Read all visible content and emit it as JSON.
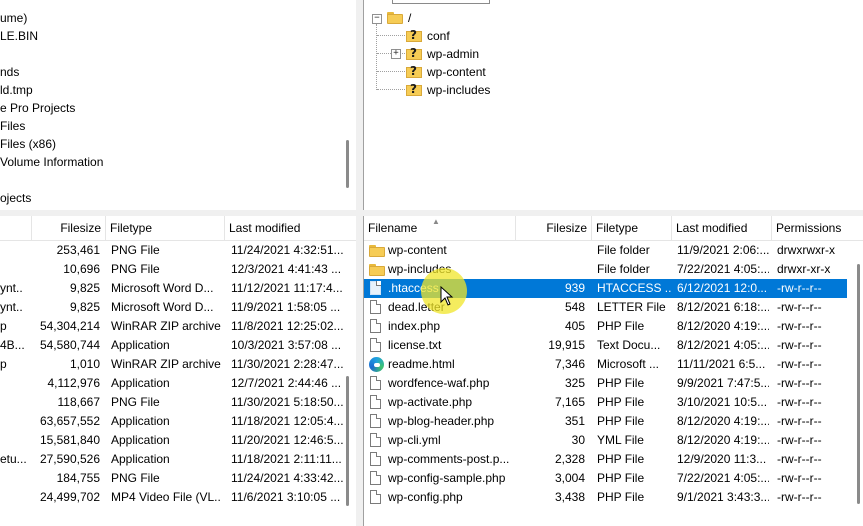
{
  "local_tree": {
    "items": [
      "ume)",
      "LE.BIN",
      "",
      "nds",
      "ld.tmp",
      "e Pro Projects",
      " Files",
      " Files (x86)",
      "Volume Information",
      "",
      "ojects"
    ]
  },
  "remote_tree": {
    "root": "/",
    "items": [
      {
        "name": "conf",
        "expander": false
      },
      {
        "name": "wp-admin",
        "expander": true
      },
      {
        "name": "wp-content",
        "expander": false
      },
      {
        "name": "wp-includes",
        "expander": false
      }
    ]
  },
  "local_list": {
    "headers": {
      "filesize": "Filesize",
      "filetype": "Filetype",
      "modified": "Last modified"
    },
    "rows": [
      {
        "name": "",
        "size": "253,461",
        "type": "PNG File",
        "modified": "11/24/2021 4:32:51..."
      },
      {
        "name": "",
        "size": "10,696",
        "type": "PNG File",
        "modified": "12/3/2021 4:41:43 ..."
      },
      {
        "name": "ynt..",
        "size": "9,825",
        "type": "Microsoft Word D...",
        "modified": "11/12/2021 11:17:4..."
      },
      {
        "name": "ynt..",
        "size": "9,825",
        "type": "Microsoft Word D...",
        "modified": "11/9/2021 1:58:05 ..."
      },
      {
        "name": "p",
        "size": "54,304,214",
        "type": "WinRAR ZIP archive",
        "modified": "11/8/2021 12:25:02..."
      },
      {
        "name": "4B...",
        "size": "54,580,744",
        "type": "Application",
        "modified": "10/3/2021 3:57:08 ..."
      },
      {
        "name": "p",
        "size": "1,010",
        "type": "WinRAR ZIP archive",
        "modified": "11/30/2021 2:28:47..."
      },
      {
        "name": "",
        "size": "4,112,976",
        "type": "Application",
        "modified": "12/7/2021 2:44:46 ..."
      },
      {
        "name": "",
        "size": "118,667",
        "type": "PNG File",
        "modified": "11/30/2021 5:18:50..."
      },
      {
        "name": "",
        "size": "63,657,552",
        "type": "Application",
        "modified": "11/18/2021 12:05:4..."
      },
      {
        "name": "",
        "size": "15,581,840",
        "type": "Application",
        "modified": "11/20/2021 12:46:5..."
      },
      {
        "name": "etu...",
        "size": "27,590,526",
        "type": "Application",
        "modified": "11/18/2021 2:11:11..."
      },
      {
        "name": "",
        "size": "184,755",
        "type": "PNG File",
        "modified": "11/24/2021 4:33:42..."
      },
      {
        "name": "",
        "size": "24,499,702",
        "type": "MP4 Video File (VL...",
        "modified": "11/6/2021 3:10:05 ..."
      }
    ]
  },
  "remote_list": {
    "headers": {
      "filename": "Filename",
      "filesize": "Filesize",
      "filetype": "Filetype",
      "modified": "Last modified",
      "permissions": "Permissions"
    },
    "rows": [
      {
        "icon": "folder",
        "name": "wp-content",
        "size": "",
        "type": "File folder",
        "modified": "11/9/2021 2:06:...",
        "perm": "drwxrwxr-x"
      },
      {
        "icon": "folder",
        "name": "wp-includes",
        "size": "",
        "type": "File folder",
        "modified": "7/22/2021 4:05:...",
        "perm": "drwxr-xr-x"
      },
      {
        "icon": "file",
        "name": ".htaccess",
        "size": "939",
        "type": "HTACCESS ...",
        "modified": "6/12/2021 12:0...",
        "perm": "-rw-r--r--",
        "selected": true
      },
      {
        "icon": "file",
        "name": "dead.letter",
        "size": "548",
        "type": "LETTER File",
        "modified": "8/12/2021 6:18:...",
        "perm": "-rw-r--r--"
      },
      {
        "icon": "file",
        "name": "index.php",
        "size": "405",
        "type": "PHP File",
        "modified": "8/12/2020 4:19:...",
        "perm": "-rw-r--r--"
      },
      {
        "icon": "file",
        "name": "license.txt",
        "size": "19,915",
        "type": "Text Docu...",
        "modified": "8/12/2021 4:05:...",
        "perm": "-rw-r--r--"
      },
      {
        "icon": "edge",
        "name": "readme.html",
        "size": "7,346",
        "type": "Microsoft ...",
        "modified": "11/11/2021 6:5...",
        "perm": "-rw-r--r--"
      },
      {
        "icon": "file",
        "name": "wordfence-waf.php",
        "size": "325",
        "type": "PHP File",
        "modified": "9/9/2021 7:47:5...",
        "perm": "-rw-r--r--"
      },
      {
        "icon": "file",
        "name": "wp-activate.php",
        "size": "7,165",
        "type": "PHP File",
        "modified": "3/10/2021 10:5...",
        "perm": "-rw-r--r--"
      },
      {
        "icon": "file",
        "name": "wp-blog-header.php",
        "size": "351",
        "type": "PHP File",
        "modified": "8/12/2020 4:19:...",
        "perm": "-rw-r--r--"
      },
      {
        "icon": "file",
        "name": "wp-cli.yml",
        "size": "30",
        "type": "YML File",
        "modified": "8/12/2020 4:19:...",
        "perm": "-rw-r--r--"
      },
      {
        "icon": "file",
        "name": "wp-comments-post.p...",
        "size": "2,328",
        "type": "PHP File",
        "modified": "12/9/2020 11:3...",
        "perm": "-rw-r--r--"
      },
      {
        "icon": "file",
        "name": "wp-config-sample.php",
        "size": "3,004",
        "type": "PHP File",
        "modified": "7/22/2021 4:05:...",
        "perm": "-rw-r--r--"
      },
      {
        "icon": "file",
        "name": "wp-config.php",
        "size": "3,438",
        "type": "PHP File",
        "modified": "9/1/2021 3:43:3...",
        "perm": "-rw-r--r--"
      }
    ]
  },
  "colors": {
    "selection": "#0078d7",
    "folder": "#f6cc55"
  }
}
